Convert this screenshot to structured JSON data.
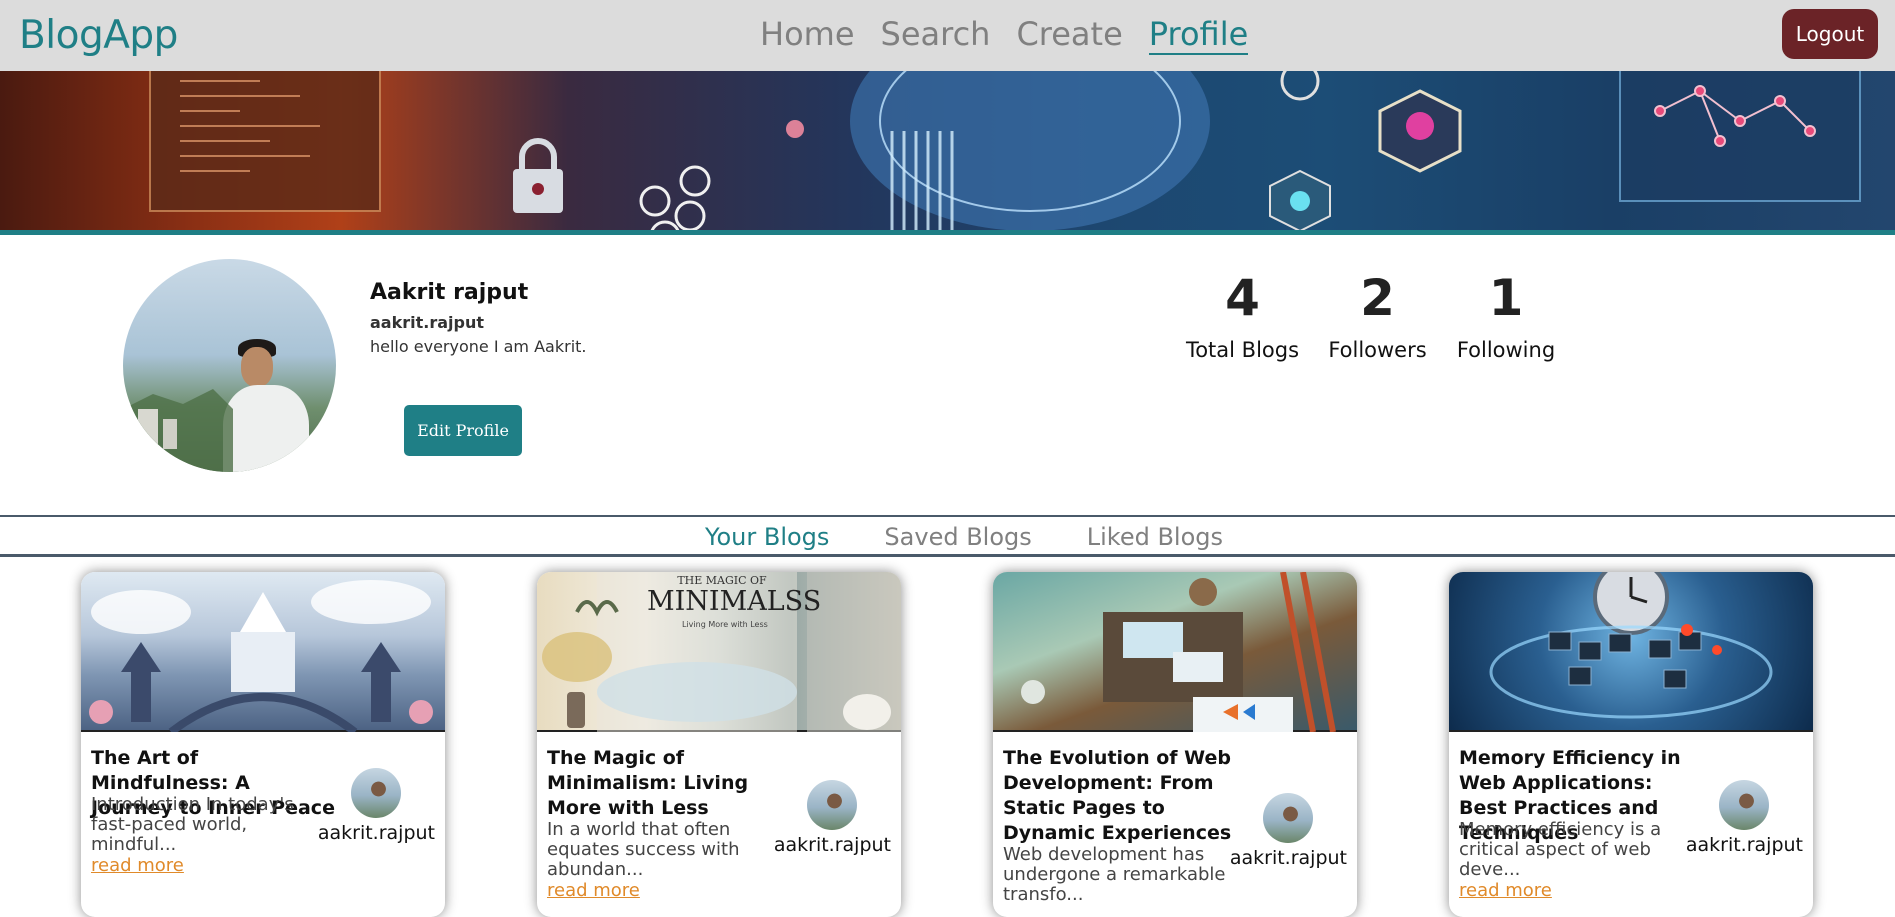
{
  "navbar": {
    "brand": "BlogApp",
    "links": [
      "Home",
      "Search",
      "Create",
      "Profile"
    ],
    "active": "Profile",
    "logout_label": "Logout"
  },
  "profile": {
    "name": "Aakrit rajput",
    "username": "aakrit.rajput",
    "bio": "hello everyone I am Aakrit.",
    "edit_label": "Edit Profile",
    "stats": [
      {
        "value": "4",
        "label": "Total Blogs"
      },
      {
        "value": "2",
        "label": "Followers"
      },
      {
        "value": "1",
        "label": "Following"
      }
    ]
  },
  "tabs": {
    "items": [
      "Your Blogs",
      "Saved Blogs",
      "Liked Blogs"
    ],
    "active": "Your Blogs"
  },
  "cards": [
    {
      "title": "The Art of Mindfulness: A Journey to Inner Peace",
      "description": "Introduction In today's fast-paced world, mindful...",
      "read_more": "read more",
      "author": "aakrit.rajput"
    },
    {
      "title": "The Magic of Minimalism: Living More with Less",
      "description": "In a world that often equates success with abundan...",
      "read_more": "read more",
      "author": "aakrit.rajput",
      "image_text": "THE MAGIC OF",
      "image_title": "MINIMALSS",
      "image_sub": "Living More with Less"
    },
    {
      "title": "The Evolution of Web Development: From Static Pages to Dynamic Experiences",
      "description": "Web development has undergone a remarkable transfo...",
      "read_more": "read more",
      "author": "aakrit.rajput"
    },
    {
      "title": "Memory Efficiency in Web Applications: Best Practices and Techniques",
      "description": "Memory efficiency is a critical aspect of web deve...",
      "read_more": "read more",
      "author": "aakrit.rajput"
    }
  ],
  "colors": {
    "accent": "#1f7f86",
    "logout": "#6b2327",
    "navbar_bg": "#dcdcdc",
    "read_more": "#e08a2a"
  }
}
